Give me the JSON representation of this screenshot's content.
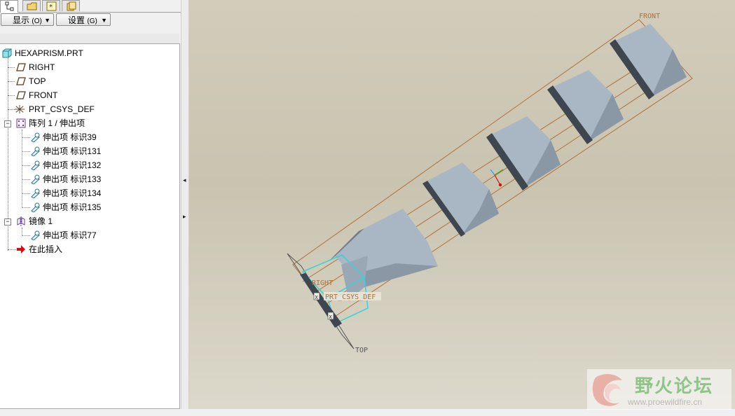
{
  "toolbar": {
    "display_label": "显示",
    "display_shortcut": "(O)",
    "settings_label": "设置",
    "settings_shortcut": "(G)"
  },
  "tree": {
    "root": "HEXAPRISM.PRT",
    "datum_right": "RIGHT",
    "datum_top": "TOP",
    "datum_front": "FRONT",
    "csys": "PRT_CSYS_DEF",
    "pattern": "阵列 1 / 伸出项",
    "pattern_items": [
      "伸出项 标识39",
      "伸出项 标识131",
      "伸出项 标识132",
      "伸出项 标识133",
      "伸出项 标识134",
      "伸出项 标识135"
    ],
    "mirror": "镜像 1",
    "mirror_item": "伸出项 标识77",
    "insert_here": "在此插入"
  },
  "viewport": {
    "label_front": "FRONT",
    "label_right": "RIGHT",
    "label_top": "TOP",
    "label_csys": "PRT_CSYS_DEF",
    "csys_mark": "X"
  },
  "watermark": {
    "title": "野火论坛",
    "url": "www.proewildfire.cn"
  },
  "colors": {
    "datum_orange": "#b0703a",
    "solid_face": "#a9b6c3",
    "solid_dark": "#3e4650",
    "highlight_cyan": "#35d3d9",
    "viewport_bg": "#cfcab7"
  },
  "icons": {
    "tab1": "model-tree-icon",
    "tab2": "folder-icon",
    "tab3": "favorites-icon",
    "tab4": "layers-icon",
    "part": "part-icon",
    "datum_plane": "datum-plane-icon",
    "csys": "csys-icon",
    "pattern": "pattern-icon",
    "protrusion": "protrusion-icon",
    "mirror": "mirror-icon",
    "insert": "insert-arrow-icon"
  }
}
